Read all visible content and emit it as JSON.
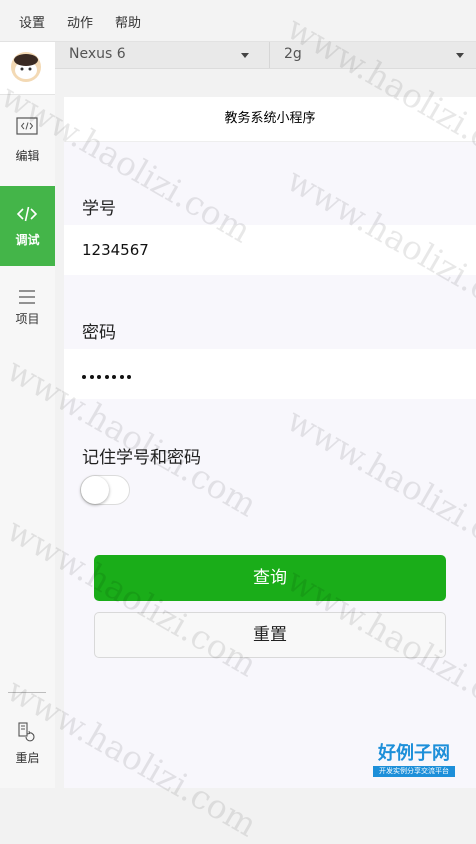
{
  "menu": {
    "items": [
      "设置",
      "动作",
      "帮助"
    ]
  },
  "sidebar": {
    "items": [
      {
        "label": "编辑",
        "icon": "code-editor-icon"
      },
      {
        "label": "调试",
        "icon": "debug-code-icon",
        "active": true
      },
      {
        "label": "项目",
        "icon": "menu-lines-icon"
      },
      {
        "label": "重启",
        "icon": "restart-icon"
      }
    ]
  },
  "toolbar": {
    "device": "Nexus 6",
    "network": "2g"
  },
  "page": {
    "title": "教务系统小程序",
    "student_id_label": "学号",
    "student_id_value": "1234567",
    "password_label": "密码",
    "password_dots": 7,
    "remember_label": "记住学号和密码",
    "remember_on": false,
    "query_button": "查询",
    "reset_button": "重置"
  },
  "watermark": {
    "text": "www.haolizi.com"
  },
  "logo": {
    "title": "好例子网",
    "subtitle": "开发实例分享交流平台"
  },
  "colors": {
    "accent": "#44b549",
    "primary_button": "#1aad19",
    "logo": "#1d8fd9"
  }
}
